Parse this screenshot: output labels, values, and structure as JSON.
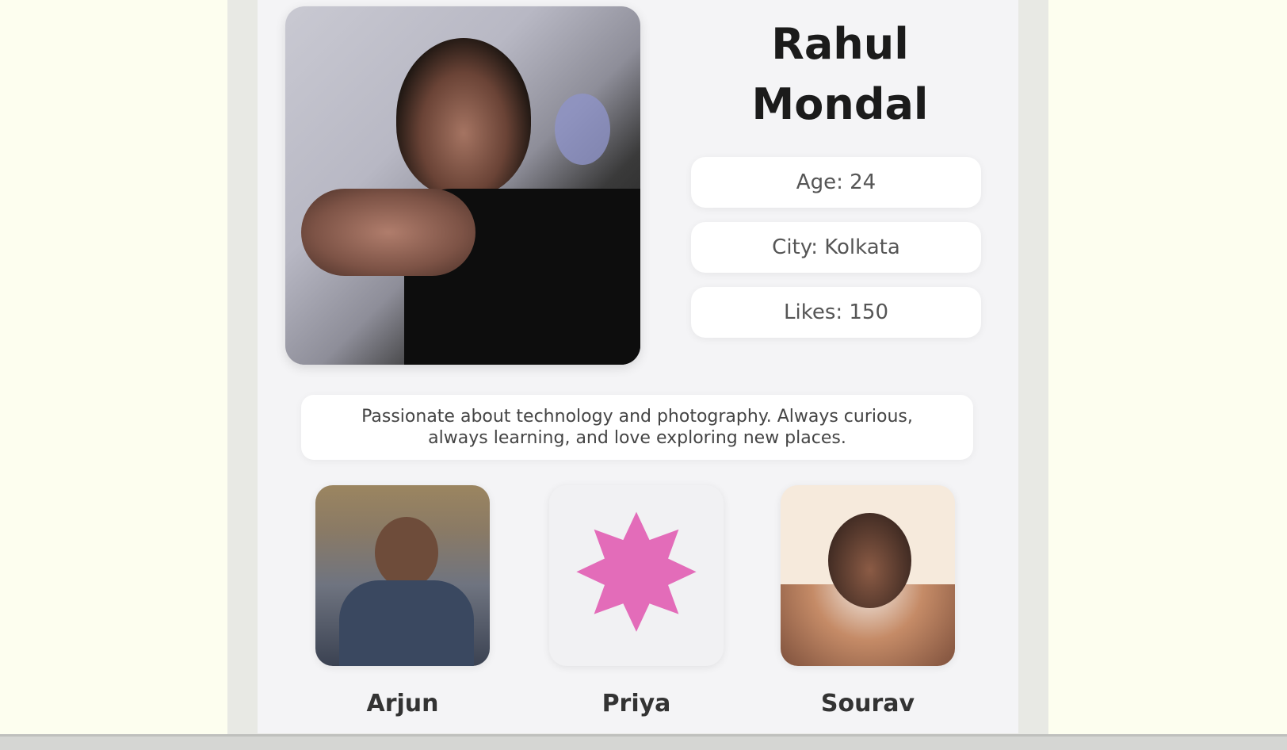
{
  "profile": {
    "name_line1": "Rahul",
    "name_line2": "Mondal",
    "photo_icon": "profile-photo",
    "info": [
      "Age: 24",
      "City: Kolkata",
      "Likes: 150"
    ],
    "bio_line1": "Passionate about technology and photography. Always curious,",
    "bio_line2": "always learning, and love exploring new places."
  },
  "friends": [
    {
      "name": "Arjun",
      "icon": "friend-photo"
    },
    {
      "name": "Priya",
      "icon": "star-icon"
    },
    {
      "name": "Sourav",
      "icon": "friend-photo"
    }
  ],
  "colors": {
    "page_background": "#fdfeef",
    "card_background": "#f4f4f6",
    "accent_pink": "#e36cb9"
  }
}
